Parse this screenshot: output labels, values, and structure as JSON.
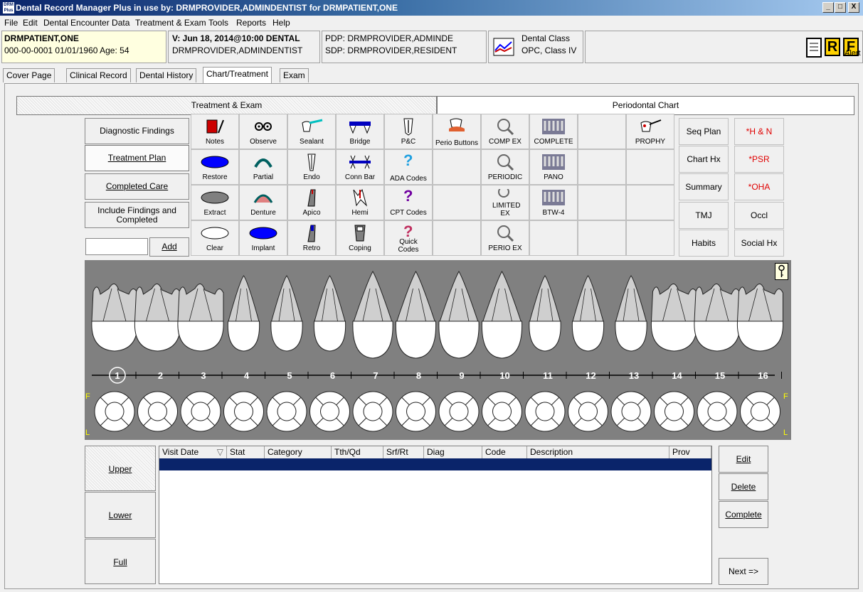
{
  "window": {
    "title": "Dental Record Manager Plus in use by: DRMPROVIDER,ADMINDENTIST for DRMPATIENT,ONE",
    "app_icon": "DRM Plus",
    "controls": [
      "_",
      "□",
      "X"
    ]
  },
  "menu": [
    "File",
    "Edit",
    "Dental Encounter Data",
    "Treatment & Exam",
    "Tools",
    "Reports",
    "Help"
  ],
  "patient": {
    "name": "DRMPATIENT,ONE",
    "id_line": "000-00-0001   01/01/1960 Age:  54",
    "visit": "V: Jun 18, 2014@10:00 DENTAL",
    "provider": "DRMPROVIDER,ADMINDENTIST",
    "pdp": "PDP: DRMPROVIDER,ADMINDE",
    "sdp": "SDP: DRMPROVIDER,RESIDENT",
    "dental_class": "Dental Class",
    "dental_class_value": "OPC, Class IV",
    "r_badge": "R",
    "f_badge": "F",
    "alert": "Alert"
  },
  "tabs": [
    "Cover Page",
    "Clinical Record",
    "Dental History",
    "Chart/Treatment",
    "Exam"
  ],
  "subtabs": {
    "left": "Treatment & Exam",
    "right": "Periodontal Chart"
  },
  "left_buttons": {
    "diagnostic": "Diagnostic Findings",
    "treatment": "Treatment Plan",
    "completed": "Completed Care",
    "include": "Include Findings and Completed",
    "add": "Add",
    "add_input": ""
  },
  "tools": {
    "notes": "Notes",
    "observe": "Observe",
    "sealant": "Sealant",
    "bridge": "Bridge",
    "pc": "P&C",
    "perio_buttons": "Perio Buttons",
    "comp_ex": "COMP EX",
    "complete": "COMPLETE",
    "prophy": "PROPHY",
    "restore": "Restore",
    "partial": "Partial",
    "endo": "Endo",
    "conn_bar": "Conn Bar",
    "ada_codes": "ADA Codes",
    "periodic": "PERIODIC",
    "pano": "PANO",
    "extract": "Extract",
    "denture": "Denture",
    "apico": "Apico",
    "hemi": "Hemi",
    "cpt_codes": "CPT Codes",
    "limited_ex": "LIMITED EX",
    "btw4": "BTW-4",
    "clear": "Clear",
    "implant": "Implant",
    "retro": "Retro",
    "coping": "Coping",
    "quick_codes": "Quick Codes",
    "perio_ex": "PERIO EX"
  },
  "right_buttons": {
    "seq_plan": "Seq Plan",
    "hn": "*H & N",
    "chart_hx": "Chart Hx",
    "psr": "*PSR",
    "summary": "Summary",
    "oha": "*OHA",
    "tmj": "TMJ",
    "occl": "Occl",
    "habits": "Habits",
    "social_hx": "Social Hx"
  },
  "chart": {
    "teeth": [
      "1",
      "2",
      "3",
      "4",
      "5",
      "6",
      "7",
      "8",
      "9",
      "10",
      "11",
      "12",
      "13",
      "14",
      "15",
      "16"
    ],
    "f_label": "F",
    "l_label": "L"
  },
  "arch_buttons": {
    "upper": "Upper",
    "lower": "Lower",
    "full": "Full"
  },
  "table": {
    "columns": [
      "Visit Date",
      "Stat",
      "Category",
      "Tth/Qd",
      "Srf/Rt",
      "Diag",
      "Code",
      "Description",
      "Prov"
    ],
    "rows": []
  },
  "action_buttons": {
    "edit": "Edit",
    "delete": "Delete",
    "complete": "Complete",
    "next": "Next =>"
  },
  "colors": {
    "red_text": "#e00000",
    "selected_row": "#0a246a",
    "chart_bg": "#808080"
  }
}
